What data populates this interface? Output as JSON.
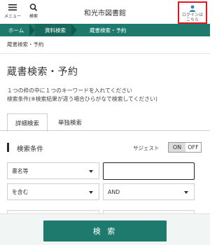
{
  "header": {
    "menu_label": "メニュー",
    "search_label": "検索",
    "site_title": "和光市図書館",
    "login_label_line1": "ログインは",
    "login_label_line2": "こちら"
  },
  "breadcrumb": {
    "home": "ホーム",
    "section": "資料検索",
    "current": "蔵書検索・予約"
  },
  "sub_breadcrumb": "蔵書検索・予約",
  "page_title": "蔵書検索・予約",
  "instructions": {
    "line1": "１つの枠の中に１つのキーワードを入れてください",
    "line2": "検索条件(※検索結果が違う場合ひらがなで検索してください)"
  },
  "tabs": {
    "active": "詳細検索",
    "inactive": "単独検索"
  },
  "conditions": {
    "title": "検索条件",
    "suggest_label": "サジェスト",
    "toggle_on": "ON",
    "toggle_off": "OFF"
  },
  "form": {
    "field_select": "書名等",
    "match_select": "を含む",
    "operator_select": "AND",
    "keyword_value": ""
  },
  "search_button": "検 索"
}
